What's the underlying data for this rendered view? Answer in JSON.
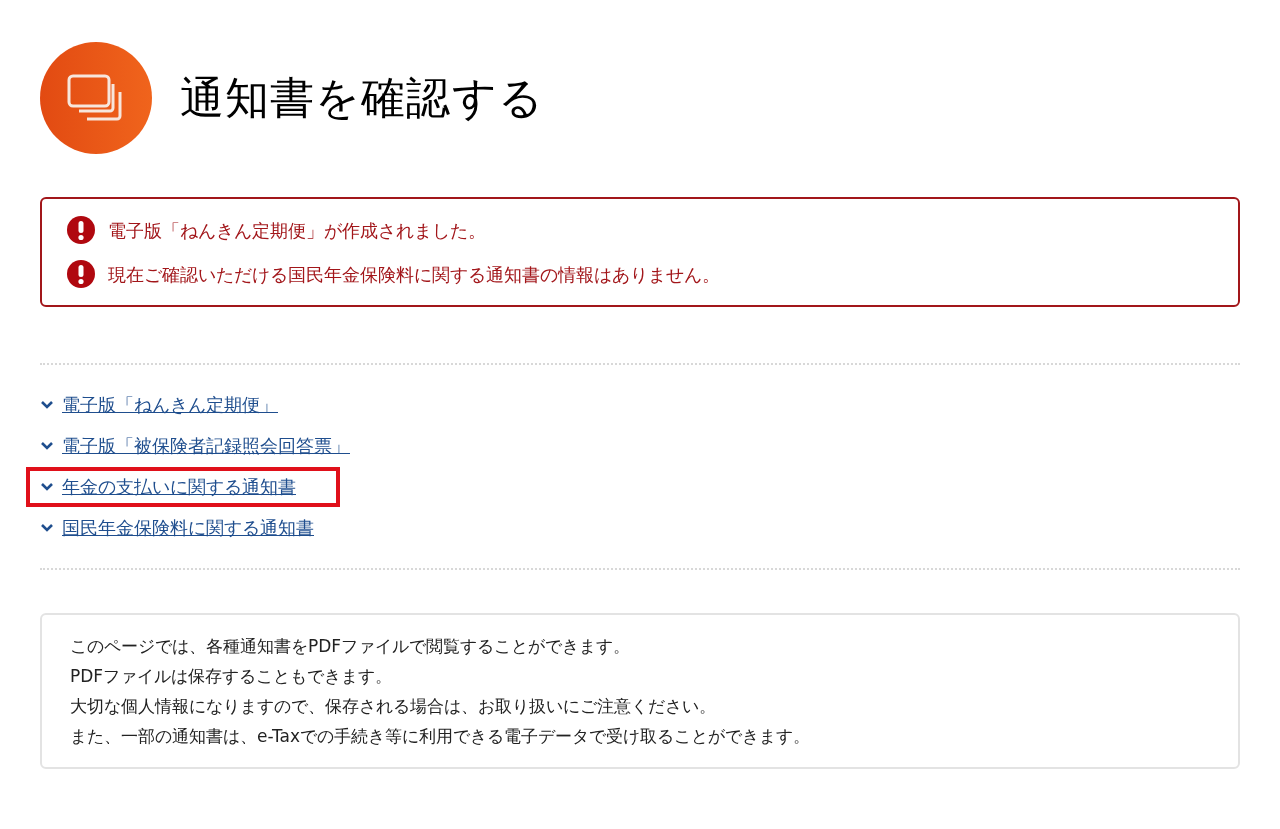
{
  "page": {
    "title": "通知書を確認する"
  },
  "alerts": [
    "電子版「ねんきん定期便」が作成されました。",
    "現在ご確認いただける国民年金保険料に関する通知書の情報はありません。"
  ],
  "links": [
    {
      "label": "電子版「ねんきん定期便」",
      "highlighted": false
    },
    {
      "label": "電子版「被保険者記録照会回答票」",
      "highlighted": false
    },
    {
      "label": "年金の支払いに関する通知書",
      "highlighted": true
    },
    {
      "label": "国民年金保険料に関する通知書",
      "highlighted": false
    }
  ],
  "info": [
    "このページでは、各種通知書をPDFファイルで閲覧することができます。",
    "PDFファイルは保存することもできます。",
    "大切な個人情報になりますので、保存される場合は、お取り扱いにご注意ください。",
    "また、一部の通知書は、e-Taxでの手続き等に利用できる電子データで受け取ることができます。"
  ]
}
